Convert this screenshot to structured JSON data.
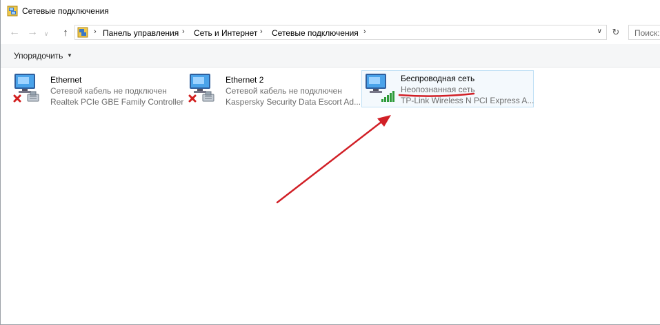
{
  "window": {
    "title": "Сетевые подключения"
  },
  "address": {
    "breadcrumbs": [
      "Панель управления",
      "Сеть и Интернет",
      "Сетевые подключения"
    ],
    "search_placeholder": "Поиск: Сетевые подключения"
  },
  "toolbar": {
    "organize_label": "Упорядочить"
  },
  "connections": [
    {
      "name": "Ethernet",
      "status": "Сетевой кабель не подключен",
      "adapter": "Realtek PCIe GBE Family Controller",
      "icon": "network-cable-disconnected-icon"
    },
    {
      "name": "Ethernet 2",
      "status": "Сетевой кабель не подключен",
      "adapter": "Kaspersky Security Data Escort Ad...",
      "icon": "network-cable-disconnected-icon"
    },
    {
      "name": "Беспроводная сеть",
      "status": "Неопознанная сеть",
      "adapter": "TP-Link Wireless N PCI Express A...",
      "icon": "wireless-signal-icon",
      "selected": true
    }
  ],
  "annotation": {
    "color": "#d11f26"
  }
}
